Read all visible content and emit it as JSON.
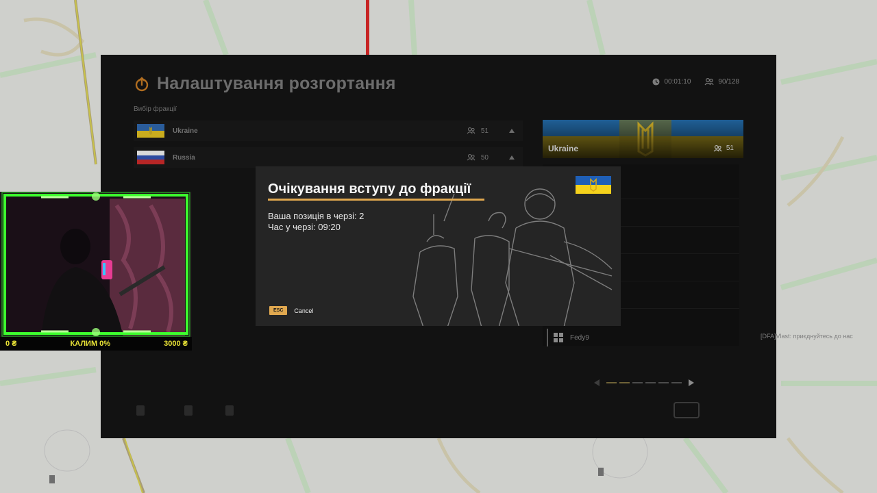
{
  "panel": {
    "title": "Налаштування розгортання",
    "timer": "00:01:10",
    "players": "90/128",
    "faction_select_label": "Вибір фракції"
  },
  "factions": [
    {
      "name": "Ukraine",
      "count": "51"
    },
    {
      "name": "Russia",
      "count": "50"
    }
  ],
  "selected_faction": {
    "name": "Ukraine",
    "count": "51"
  },
  "roster": [
    {
      "name": "Fedy9"
    }
  ],
  "dialog": {
    "title": "Очікування вступу до фракції",
    "position_text": "Ваша позиція в черзі: 2",
    "time_text": "Час у черзі: 09:20",
    "esc_key": "ESC",
    "cancel_label": "Cancel"
  },
  "webcam_stats": {
    "left": "0 ₴",
    "center": "КАЛИМ 0%",
    "right": "3000 ₴"
  },
  "chat": {
    "line": "[DFA]Vlast: приєднуйтесь до нас"
  },
  "colors": {
    "accent": "#e0a84f",
    "ukraine_blue": "#1f5fb6",
    "ukraine_yellow": "#f5d21c",
    "russia_white": "#e8e8e8",
    "russia_blue": "#2b4fb0",
    "russia_red": "#c62828",
    "neon_green": "#3dff2e",
    "stats_yellow": "#e9e236"
  },
  "icons": {
    "title": "spawn-icon",
    "timer": "clock-icon",
    "players": "players-icon"
  }
}
